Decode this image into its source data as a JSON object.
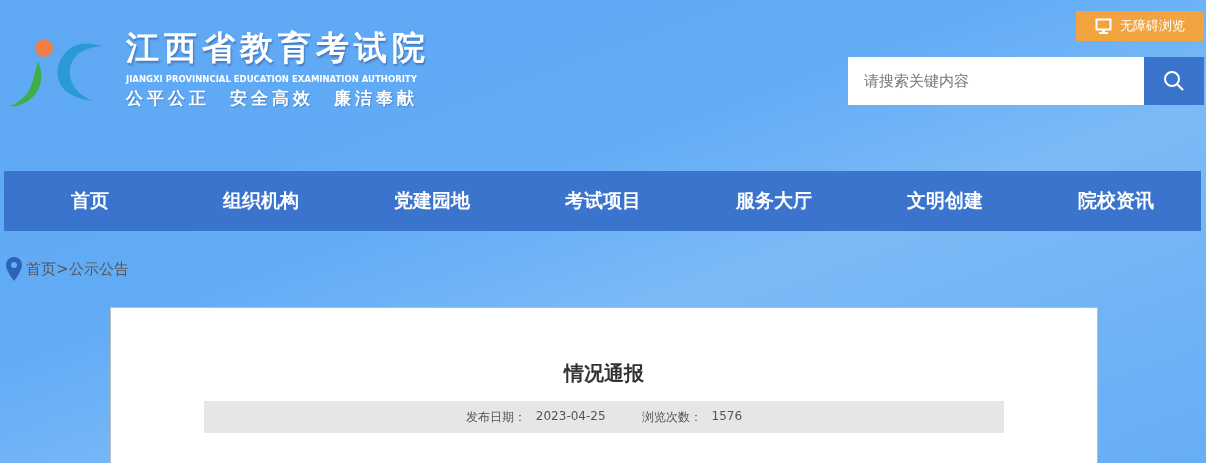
{
  "header": {
    "site_title": "江西省教育考试院",
    "site_subtitle": "JIANGXI PROVINNCIAL EDUCATION EXAMINATION AUTHORITY",
    "slogan": "公平公正  安全高效  廉洁奉献",
    "accessibility_button": "无障碍浏览",
    "search": {
      "placeholder": "请搜索关键内容"
    }
  },
  "nav": [
    {
      "label": "首页",
      "selected": false
    },
    {
      "label": "组织机构",
      "selected": false
    },
    {
      "label": "党建园地",
      "selected": false
    },
    {
      "label": "考试项目",
      "selected": false
    },
    {
      "label": "服务大厅",
      "selected": false
    },
    {
      "label": "文明创建",
      "selected": false
    },
    {
      "label": "院校资讯",
      "selected": false
    }
  ],
  "breadcrumb": [
    {
      "label": "首页"
    },
    {
      "label": ">"
    },
    {
      "label": "公示公告"
    }
  ],
  "article": {
    "title": "情况通报",
    "publish_date_label": "发布日期：",
    "publish_date": "2023-04-25",
    "views_label": "浏览次数：",
    "views": "1576"
  }
}
